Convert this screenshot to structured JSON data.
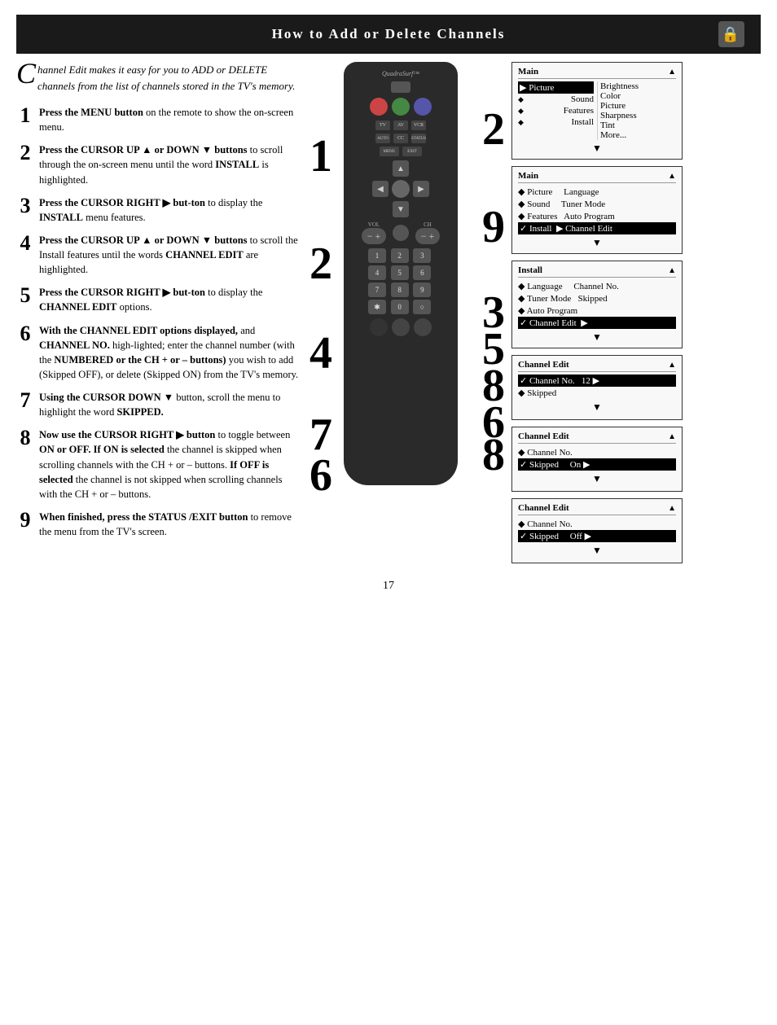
{
  "header": {
    "title": "How to Add or Delete Channels",
    "icon": "🔒"
  },
  "intro": {
    "drop_cap": "C",
    "text": "hannel Edit makes it easy for you to ADD or DELETE channels from the list of channels stored in the TV's memory."
  },
  "steps": [
    {
      "number": "1",
      "text_parts": [
        {
          "bold": "Press the MENU button",
          "normal": " on the remote to show the on-screen menu."
        }
      ]
    },
    {
      "number": "2",
      "text_parts": [
        {
          "bold": "Press the CURSOR UP ▲ or DOWN ▼ buttons",
          "normal": " to scroll through the on-screen menu until the word "
        },
        {
          "bold": "INSTALL",
          "normal": " is highlighted."
        }
      ]
    },
    {
      "number": "3",
      "text_parts": [
        {
          "bold": "Press the CURSOR RIGHT ▶ but-ton",
          "normal": " to display the "
        },
        {
          "bold": "INSTALL",
          "normal": " menu features."
        }
      ]
    },
    {
      "number": "4",
      "text_parts": [
        {
          "bold": "Press the CURSOR UP ▲ or DOWN ▼ buttons",
          "normal": " to scroll the Install features until the words "
        },
        {
          "bold": "CHANNEL EDIT",
          "normal": " are highlighted."
        }
      ]
    },
    {
      "number": "5",
      "text_parts": [
        {
          "bold": "Press the CURSOR RIGHT ▶ but-ton",
          "normal": " to display the "
        },
        {
          "bold": "CHANNEL EDIT",
          "normal": " options."
        }
      ]
    },
    {
      "number": "6",
      "text_parts": [
        {
          "bold": "With the CHANNEL EDIT options displayed,",
          "normal": " and "
        },
        {
          "bold": "CHANNEL NO.",
          "normal": " high-lighted; enter the channel number (with the "
        },
        {
          "bold": "NUMBERED or the CH + or – buttons)",
          "normal": " you wish to add (Skipped OFF), or delete (Skipped ON) from the TV's memory."
        }
      ]
    },
    {
      "number": "7",
      "text_parts": [
        {
          "bold": "Using the CURSOR DOWN ▼",
          "normal": " button, scroll the menu to highlight the word "
        },
        {
          "bold": "SKIPPED."
        }
      ]
    },
    {
      "number": "8",
      "text_parts": [
        {
          "bold": "Now use the CURSOR RIGHT ▶ button",
          "normal": " to toggle between "
        },
        {
          "bold": "ON or OFF.",
          "normal": " "
        },
        {
          "bold": "If ON is selected",
          "normal": " the channel is skipped when scrolling channels with the CH + or – buttons. "
        },
        {
          "bold": "If OFF is selected",
          "normal": " the channel is not skipped when scrolling channels with the CH + or – buttons."
        }
      ]
    },
    {
      "number": "9",
      "text_parts": [
        {
          "bold": "When finished, press the STATUS /EXIT button",
          "normal": " to remove the menu from the TV's screen."
        }
      ]
    }
  ],
  "menus": [
    {
      "id": "menu1",
      "title": "Main",
      "title_arrow": "▲",
      "rows": [
        {
          "type": "selected",
          "label": "▶ Picture",
          "value": "Brightness"
        },
        {
          "type": "diamond",
          "label": "Sound",
          "value": "Color"
        },
        {
          "type": "diamond",
          "label": "Features",
          "value": "Picture"
        },
        {
          "type": "diamond",
          "label": "Install",
          "value": "Sharpness"
        },
        {
          "type": "empty",
          "label": "",
          "value": "Tint"
        },
        {
          "type": "empty",
          "label": "",
          "value": "More..."
        }
      ],
      "footer_arrow": "▼"
    },
    {
      "id": "menu2",
      "title": "Main",
      "title_arrow": "▲",
      "rows": [
        {
          "type": "diamond",
          "label": "Picture",
          "value": "Language"
        },
        {
          "type": "diamond",
          "label": "Sound",
          "value": "Tuner Mode"
        },
        {
          "type": "diamond",
          "label": "Features",
          "value": "Auto Program"
        },
        {
          "type": "selected",
          "label": "✓ Install",
          "value": "▶ Channel Edit"
        }
      ],
      "footer_arrow": "▼"
    },
    {
      "id": "menu3",
      "title": "Install",
      "title_arrow": "▲",
      "rows": [
        {
          "type": "diamond",
          "label": "Language",
          "value": "Channel No."
        },
        {
          "type": "diamond",
          "label": "Tuner Mode",
          "value": "Skipped"
        },
        {
          "type": "diamond",
          "label": "Auto Program",
          "value": ""
        },
        {
          "type": "selected",
          "label": "✓ Channel Edit",
          "value": "▶"
        }
      ],
      "footer_arrow": "▼"
    },
    {
      "id": "menu4",
      "title": "Channel Edit",
      "title_arrow": "▲",
      "rows": [
        {
          "type": "selected",
          "label": "✓ Channel No.",
          "value": "12 ▶"
        },
        {
          "type": "diamond",
          "label": "Skipped",
          "value": ""
        }
      ],
      "footer_arrow": "▼"
    },
    {
      "id": "menu5",
      "title": "Channel Edit",
      "title_arrow": "▲",
      "rows": [
        {
          "type": "diamond",
          "label": "Channel No.",
          "value": ""
        },
        {
          "type": "selected",
          "label": "✓ Skipped",
          "value": "On ▶"
        }
      ],
      "footer_arrow": "▼"
    },
    {
      "id": "menu6",
      "title": "Channel Edit",
      "title_arrow": "▲",
      "rows": [
        {
          "type": "diamond",
          "label": "Channel No.",
          "value": ""
        },
        {
          "type": "selected",
          "label": "✓ Skipped",
          "value": "Off ▶"
        }
      ],
      "footer_arrow": "▼"
    }
  ],
  "page_number": "17",
  "remote": {
    "brand": "QuadraSurf™",
    "numpad": [
      "1",
      "2",
      "3",
      "4",
      "5",
      "6",
      "7",
      "8",
      "9",
      "0",
      "·",
      "○"
    ]
  },
  "big_numbers": {
    "n2": "2",
    "n4": "4",
    "n7": "7",
    "n6": "6",
    "n9": "9",
    "n2b": "2",
    "n3": "3",
    "n5": "5",
    "n8": "8",
    "n6b": "6",
    "n8b": "8",
    "n1": "1"
  }
}
